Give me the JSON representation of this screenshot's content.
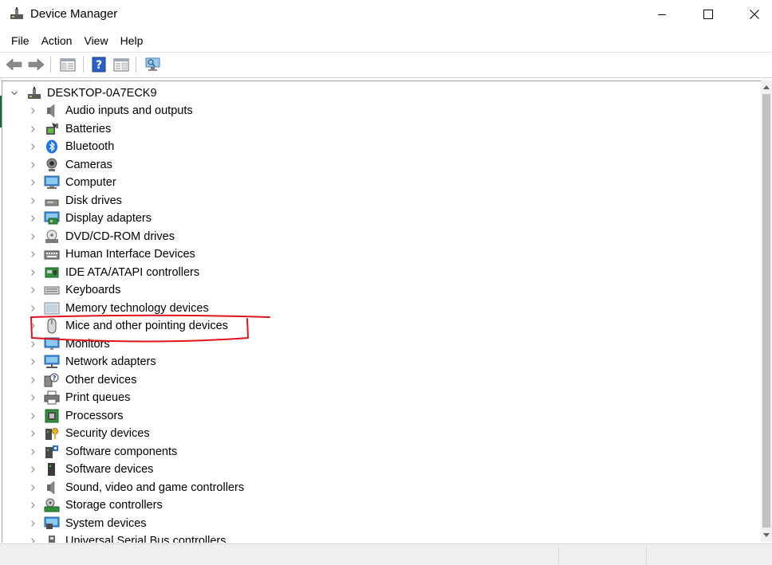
{
  "window": {
    "title": "Device Manager"
  },
  "menu": [
    "File",
    "Action",
    "View",
    "Help"
  ],
  "toolbar": {
    "buttons": [
      "back-icon",
      "forward-icon",
      "show-hide-console-tree-icon",
      "help-icon",
      "properties-icon",
      "scan-hardware-icon"
    ]
  },
  "tree": {
    "root": "DESKTOP-0A7ECK9",
    "items": [
      {
        "label": "Audio inputs and outputs",
        "icon": "speaker-icon"
      },
      {
        "label": "Batteries",
        "icon": "battery-icon"
      },
      {
        "label": "Bluetooth",
        "icon": "bluetooth-icon"
      },
      {
        "label": "Cameras",
        "icon": "camera-icon"
      },
      {
        "label": "Computer",
        "icon": "computer-icon"
      },
      {
        "label": "Disk drives",
        "icon": "disk-drive-icon"
      },
      {
        "label": "Display adapters",
        "icon": "display-adapter-icon"
      },
      {
        "label": "DVD/CD-ROM drives",
        "icon": "dvd-drive-icon"
      },
      {
        "label": "Human Interface Devices",
        "icon": "hid-icon"
      },
      {
        "label": "IDE ATA/ATAPI controllers",
        "icon": "ide-controller-icon"
      },
      {
        "label": "Keyboards",
        "icon": "keyboard-icon"
      },
      {
        "label": "Memory technology devices",
        "icon": "memory-icon"
      },
      {
        "label": "Mice and other pointing devices",
        "icon": "mouse-icon"
      },
      {
        "label": "Monitors",
        "icon": "monitor-icon"
      },
      {
        "label": "Network adapters",
        "icon": "network-adapter-icon"
      },
      {
        "label": "Other devices",
        "icon": "unknown-device-icon"
      },
      {
        "label": "Print queues",
        "icon": "printer-icon"
      },
      {
        "label": "Processors",
        "icon": "processor-icon"
      },
      {
        "label": "Security devices",
        "icon": "security-device-icon"
      },
      {
        "label": "Software components",
        "icon": "software-component-icon"
      },
      {
        "label": "Software devices",
        "icon": "software-device-icon"
      },
      {
        "label": "Sound, video and game controllers",
        "icon": "sound-controller-icon"
      },
      {
        "label": "Storage controllers",
        "icon": "storage-controller-icon"
      },
      {
        "label": "System devices",
        "icon": "system-device-icon"
      },
      {
        "label": "Universal Serial Bus controllers",
        "icon": "usb-icon"
      }
    ]
  },
  "annotation": {
    "color": "#e0121b",
    "target": "Mice and other pointing devices"
  }
}
